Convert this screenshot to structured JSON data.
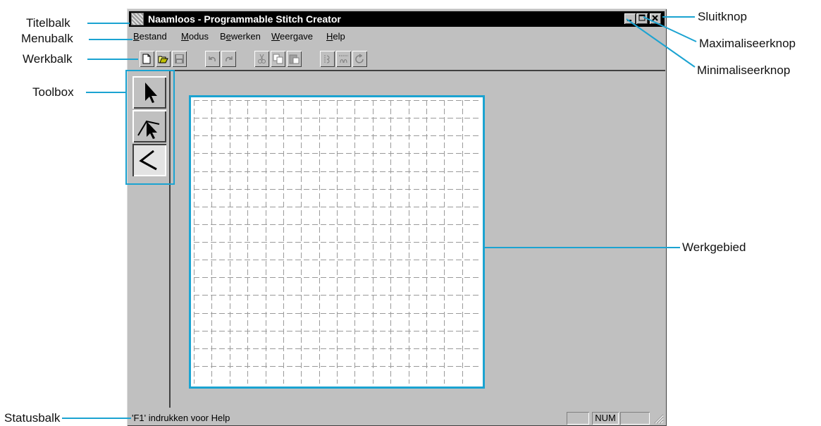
{
  "window": {
    "title": "Naamloos - Programmable Stitch Creator",
    "caption_buttons": [
      "minimize-icon",
      "maximize-icon",
      "close-icon"
    ]
  },
  "menubar": {
    "items": [
      {
        "label": "Bestand",
        "underline": "B",
        "rest": "estand"
      },
      {
        "label": "Modus",
        "underline": "M",
        "rest": "odus"
      },
      {
        "label": "Bewerken",
        "pre": "B",
        "underline": "e",
        "rest": "werken"
      },
      {
        "label": "Weergave",
        "underline": "W",
        "rest": "eergave"
      },
      {
        "label": "Help",
        "underline": "H",
        "rest": "elp"
      }
    ]
  },
  "toolbar": {
    "buttons": [
      "new-file-icon",
      "open-folder-icon",
      "save-icon",
      "undo-icon",
      "redo-icon",
      "cut-icon",
      "copy-icon",
      "paste-icon",
      "mirror-horizontal-icon",
      "mirror-vertical-icon",
      "rotate-icon"
    ]
  },
  "toolbox": {
    "tools": [
      "select-arrow-icon",
      "point-edit-icon",
      "stitch-line-icon"
    ]
  },
  "statusbar": {
    "text": "'F1' indrukken voor Help",
    "num_indicator": "NUM"
  },
  "callouts": {
    "titelbalk": "Titelbalk",
    "menubalk": "Menubalk",
    "werkbalk": "Werkbalk",
    "toolbox": "Toolbox",
    "statusbalk": "Statusbalk",
    "sluitknop": "Sluitknop",
    "maximaliseerknop": "Maximaliseerknop",
    "minimaliseerknop": "Minimaliseerknop",
    "werkgebied": "Werkgebied"
  },
  "colors": {
    "callout_line": "#1ba3d1",
    "window_face": "#c0c0c0",
    "titlebar": "#000000"
  }
}
